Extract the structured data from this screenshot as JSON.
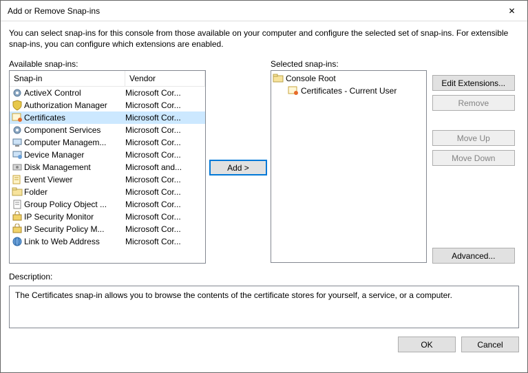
{
  "title": "Add or Remove Snap-ins",
  "intro": "You can select snap-ins for this console from those available on your computer and configure the selected set of snap-ins. For extensible snap-ins, you can configure which extensions are enabled.",
  "available_label": "Available snap-ins:",
  "selected_label": "Selected snap-ins:",
  "headers": {
    "snapin": "Snap-in",
    "vendor": "Vendor"
  },
  "add_label": "Add >",
  "rows": [
    {
      "name": "ActiveX Control",
      "vendor": "Microsoft Cor...",
      "icon": "gear",
      "selected": false
    },
    {
      "name": "Authorization Manager",
      "vendor": "Microsoft Cor...",
      "icon": "shield",
      "selected": false
    },
    {
      "name": "Certificates",
      "vendor": "Microsoft Cor...",
      "icon": "cert",
      "selected": true
    },
    {
      "name": "Component Services",
      "vendor": "Microsoft Cor...",
      "icon": "gear",
      "selected": false
    },
    {
      "name": "Computer Managem...",
      "vendor": "Microsoft Cor...",
      "icon": "computer",
      "selected": false
    },
    {
      "name": "Device Manager",
      "vendor": "Microsoft Cor...",
      "icon": "device",
      "selected": false
    },
    {
      "name": "Disk Management",
      "vendor": "Microsoft and...",
      "icon": "disk",
      "selected": false
    },
    {
      "name": "Event Viewer",
      "vendor": "Microsoft Cor...",
      "icon": "event",
      "selected": false
    },
    {
      "name": "Folder",
      "vendor": "Microsoft Cor...",
      "icon": "folder",
      "selected": false
    },
    {
      "name": "Group Policy Object ...",
      "vendor": "Microsoft Cor...",
      "icon": "scroll",
      "selected": false
    },
    {
      "name": "IP Security Monitor",
      "vendor": "Microsoft Cor...",
      "icon": "ipsec",
      "selected": false
    },
    {
      "name": "IP Security Policy M...",
      "vendor": "Microsoft Cor...",
      "icon": "ipsec",
      "selected": false
    },
    {
      "name": "Link to Web Address",
      "vendor": "Microsoft Cor...",
      "icon": "link",
      "selected": false
    }
  ],
  "tree": {
    "root": "Console Root",
    "children": [
      {
        "label": "Certificates - Current User",
        "icon": "cert"
      }
    ]
  },
  "buttons": {
    "edit_ext": "Edit Extensions...",
    "remove": "Remove",
    "move_up": "Move Up",
    "move_down": "Move Down",
    "advanced": "Advanced..."
  },
  "description_label": "Description:",
  "description_text": "The Certificates snap-in allows you to browse the contents of the certificate stores for yourself, a service, or a computer.",
  "footer": {
    "ok": "OK",
    "cancel": "Cancel"
  }
}
